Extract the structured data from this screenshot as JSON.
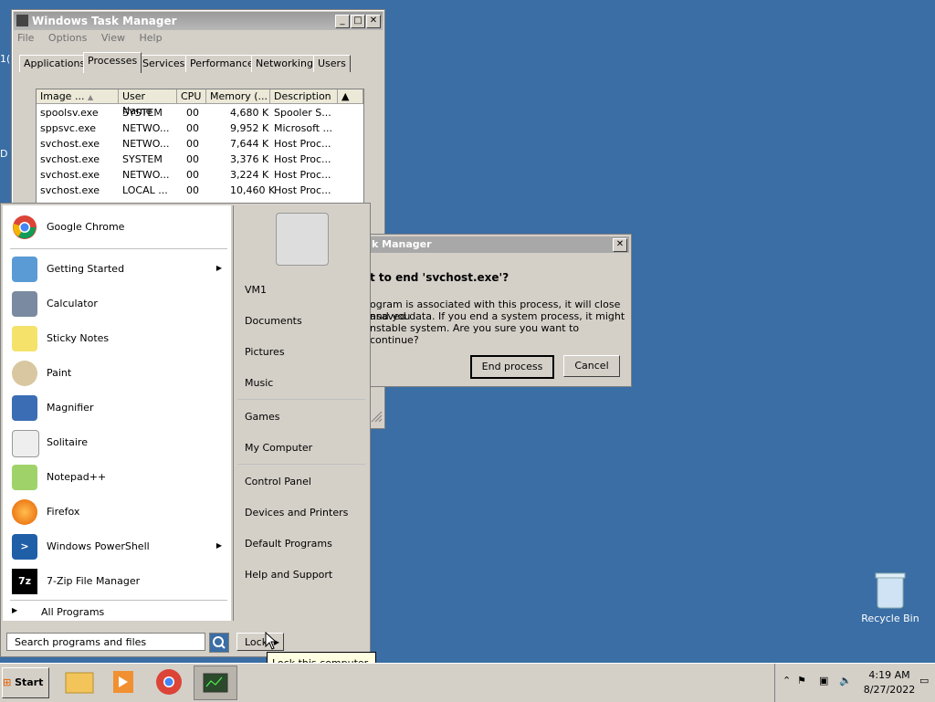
{
  "task_manager": {
    "title": "Windows Task Manager",
    "menu": [
      "File",
      "Options",
      "View",
      "Help"
    ],
    "tabs": [
      "Applications",
      "Processes",
      "Services",
      "Performance",
      "Networking",
      "Users"
    ],
    "active_tab": "Processes",
    "columns": [
      "Image ...",
      "User Name",
      "CPU",
      "Memory (...",
      "Description"
    ],
    "rows": [
      {
        "image": "spoolsv.exe",
        "user": "SYSTEM",
        "cpu": "00",
        "memory": "4,680 K",
        "desc": "Spooler S..."
      },
      {
        "image": "sppsvc.exe",
        "user": "NETWO...",
        "cpu": "00",
        "memory": "9,952 K",
        "desc": "Microsoft ..."
      },
      {
        "image": "svchost.exe",
        "user": "NETWO...",
        "cpu": "00",
        "memory": "7,644 K",
        "desc": "Host Proc..."
      },
      {
        "image": "svchost.exe",
        "user": "SYSTEM",
        "cpu": "00",
        "memory": "3,376 K",
        "desc": "Host Proc..."
      },
      {
        "image": "svchost.exe",
        "user": "NETWO...",
        "cpu": "00",
        "memory": "3,224 K",
        "desc": "Host Proc..."
      },
      {
        "image": "svchost.exe",
        "user": "LOCAL ...",
        "cpu": "00",
        "memory": "10,460 K",
        "desc": "Host Proc..."
      }
    ]
  },
  "start_menu": {
    "pinned": [
      {
        "label": "Google Chrome",
        "icon": "chrome-icon"
      }
    ],
    "programs": [
      {
        "label": "Getting Started",
        "icon": "getting-started-icon",
        "submenu": true
      },
      {
        "label": "Calculator",
        "icon": "calculator-icon"
      },
      {
        "label": "Sticky Notes",
        "icon": "sticky-notes-icon"
      },
      {
        "label": "Paint",
        "icon": "paint-icon"
      },
      {
        "label": "Magnifier",
        "icon": "magnifier-icon"
      },
      {
        "label": "Solitaire",
        "icon": "solitaire-icon"
      },
      {
        "label": "Notepad++",
        "icon": "notepadpp-icon"
      },
      {
        "label": "Firefox",
        "icon": "firefox-icon"
      },
      {
        "label": "Windows PowerShell",
        "icon": "powershell-icon",
        "submenu": true
      },
      {
        "label": "7-Zip File Manager",
        "icon": "7zip-icon"
      }
    ],
    "all_programs": "All Programs",
    "right_items": [
      "VM1",
      "Documents",
      "Pictures",
      "Music",
      "Games",
      "My Computer",
      "Control Panel",
      "Devices and Printers",
      "Default Programs",
      "Help and Support"
    ],
    "search_placeholder": "Search programs and files",
    "lock_label": "Lock",
    "tooltip": "Lock this computer."
  },
  "dialog": {
    "title": "k Manager",
    "question": "t to end 'svchost.exe'?",
    "body_lines": [
      "ogram is associated with this process, it will close and you",
      "nsaved data. If you end a system process, it might",
      "nstable system. Are you sure you want to continue?"
    ],
    "end_label": "End process",
    "cancel_label": "Cancel"
  },
  "desktop": {
    "recycle_bin": "Recycle Bin"
  },
  "taskbar": {
    "start_label": "Start",
    "clock_time": "4:19 AM",
    "clock_date": "8/27/2022"
  },
  "colors": {
    "desktop": "#3a6ea5",
    "window_face": "#d4d0c8"
  }
}
